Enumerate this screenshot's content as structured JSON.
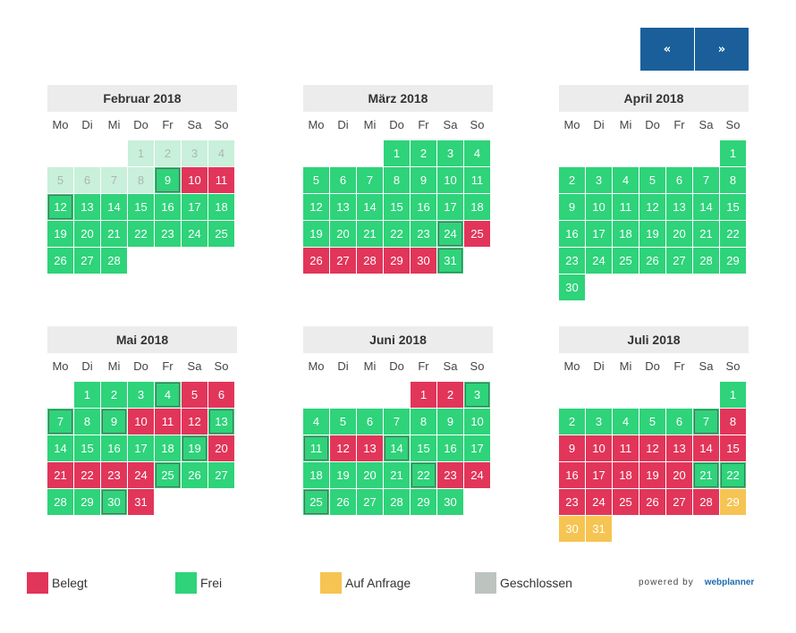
{
  "nav": {
    "prev_label": "«",
    "next_label": "»"
  },
  "colors": {
    "free": "#2ed37a",
    "booked": "#e2355a",
    "request": "#f6c452",
    "closed": "#bdc3bf",
    "nav": "#1a5f99"
  },
  "weekdays": [
    "Mo",
    "Di",
    "Mi",
    "Do",
    "Fr",
    "Sa",
    "So"
  ],
  "months": [
    {
      "title": "Februar 2018",
      "offset": 3,
      "days": 28,
      "past": [
        1,
        2,
        3,
        4,
        5,
        6,
        7,
        8
      ],
      "booked": [
        10,
        11
      ],
      "request": [],
      "outlined": [
        9,
        12
      ]
    },
    {
      "title": "März 2018",
      "offset": 3,
      "days": 31,
      "past": [],
      "booked": [
        25,
        26,
        27,
        28,
        29,
        30
      ],
      "request": [],
      "outlined": [
        24,
        31
      ]
    },
    {
      "title": "April 2018",
      "offset": 6,
      "days": 30,
      "past": [],
      "booked": [],
      "request": [],
      "outlined": []
    },
    {
      "title": "Mai 2018",
      "offset": 1,
      "days": 31,
      "past": [],
      "booked": [
        5,
        6,
        10,
        11,
        12,
        20,
        21,
        22,
        23,
        24,
        31
      ],
      "request": [],
      "outlined": [
        4,
        7,
        9,
        13,
        19,
        25,
        30
      ]
    },
    {
      "title": "Juni 2018",
      "offset": 4,
      "days": 30,
      "past": [],
      "booked": [
        1,
        2,
        12,
        13,
        23,
        24
      ],
      "request": [],
      "outlined": [
        3,
        11,
        14,
        22,
        25
      ]
    },
    {
      "title": "Juli 2018",
      "offset": 6,
      "days": 31,
      "past": [],
      "booked": [
        8,
        9,
        10,
        11,
        12,
        13,
        14,
        15,
        16,
        17,
        18,
        19,
        20,
        23,
        24,
        25,
        26,
        27,
        28
      ],
      "request": [
        29,
        30,
        31
      ],
      "outlined": [
        7,
        21,
        22
      ]
    }
  ],
  "legend": {
    "booked": "Belegt",
    "free": "Frei",
    "request": "Auf Anfrage",
    "closed": "Geschlossen"
  },
  "powered": {
    "text": "powered by",
    "brand": "webplanner"
  }
}
